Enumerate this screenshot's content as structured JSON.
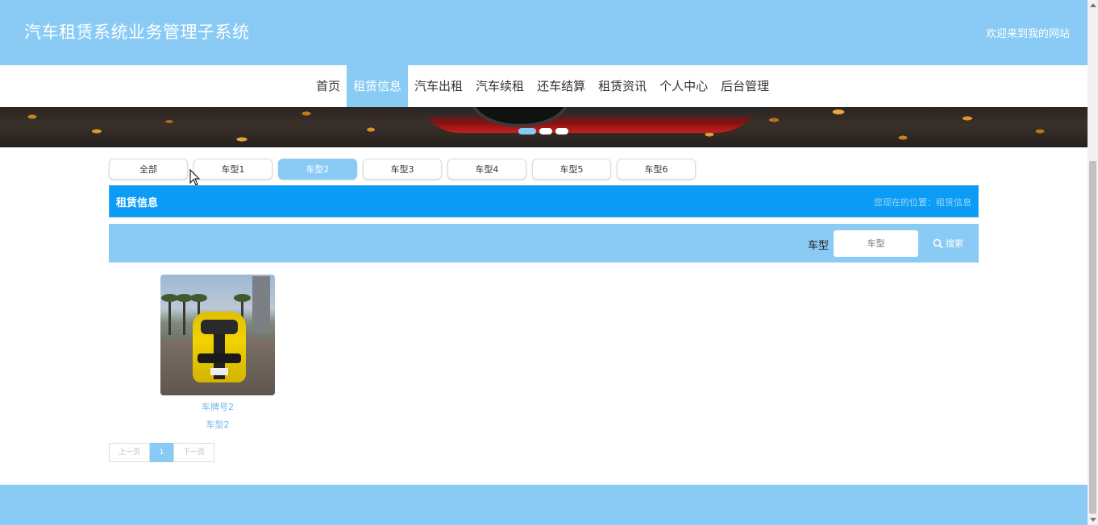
{
  "header": {
    "site_title": "汽车租赁系统业务管理子系统",
    "welcome": "欢迎来到我的网站"
  },
  "nav": {
    "items": [
      {
        "label": "首页",
        "active": false
      },
      {
        "label": "租赁信息",
        "active": true
      },
      {
        "label": "汽车出租",
        "active": false
      },
      {
        "label": "汽车续租",
        "active": false
      },
      {
        "label": "还车结算",
        "active": false
      },
      {
        "label": "租赁资讯",
        "active": false
      },
      {
        "label": "个人中心",
        "active": false
      },
      {
        "label": "后台管理",
        "active": false
      }
    ]
  },
  "banner": {
    "slides_total": 3,
    "active_slide": 1
  },
  "categories": {
    "items": [
      {
        "label": "全部",
        "active": false
      },
      {
        "label": "车型1",
        "active": false
      },
      {
        "label": "车型2",
        "active": true
      },
      {
        "label": "车型3",
        "active": false
      },
      {
        "label": "车型4",
        "active": false
      },
      {
        "label": "车型5",
        "active": false
      },
      {
        "label": "车型6",
        "active": false
      }
    ]
  },
  "section": {
    "title": "租赁信息",
    "breadcrumb": "您现在的位置：租赁信息"
  },
  "search": {
    "label": "车型",
    "placeholder": "车型",
    "button_label": "搜索",
    "button_icon": "search-icon"
  },
  "listing": {
    "cards": [
      {
        "plate": "车牌号2",
        "type": "车型2",
        "image": "yellow-sports-car-photo"
      }
    ]
  },
  "pagination": {
    "prev_label": "上一页",
    "current_page": "1",
    "next_label": "下一页"
  },
  "colors": {
    "primary_light": "#89cbf5",
    "primary_strong": "#0b9cf5",
    "link": "#6bb6e8"
  }
}
